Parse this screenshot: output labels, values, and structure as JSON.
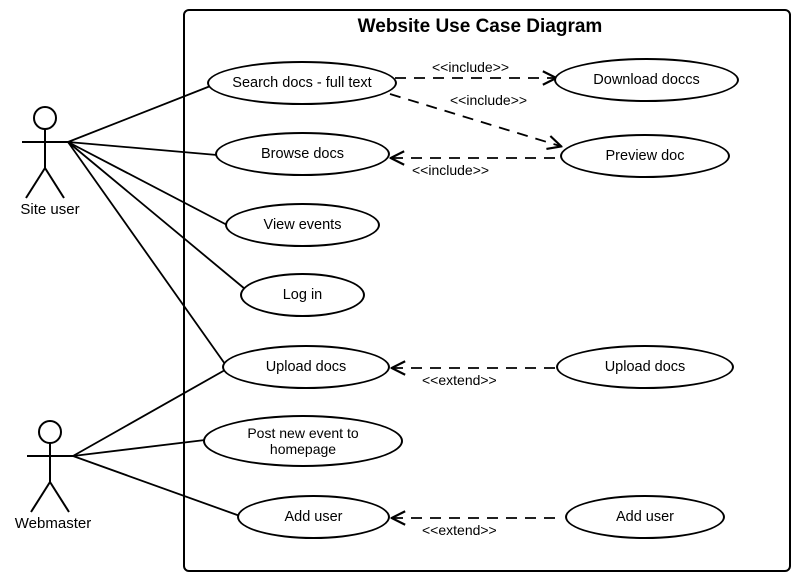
{
  "title": "Website Use Case Diagram",
  "actors": {
    "site_user": "Site user",
    "webmaster": "Webmaster"
  },
  "usecases": {
    "search_docs": "Search docs - full text",
    "browse_docs": "Browse docs",
    "view_events": "View events",
    "log_in": "Log in",
    "upload_docs_left": "Upload docs",
    "post_event": "Post new event to homepage",
    "add_user_left": "Add user",
    "download_doccs": "Download doccs",
    "preview_doc": "Preview doc",
    "upload_docs_right": "Upload docs",
    "add_user_right": "Add user"
  },
  "stereotypes": {
    "include": "<<include>>",
    "extend": "<<extend>>"
  }
}
